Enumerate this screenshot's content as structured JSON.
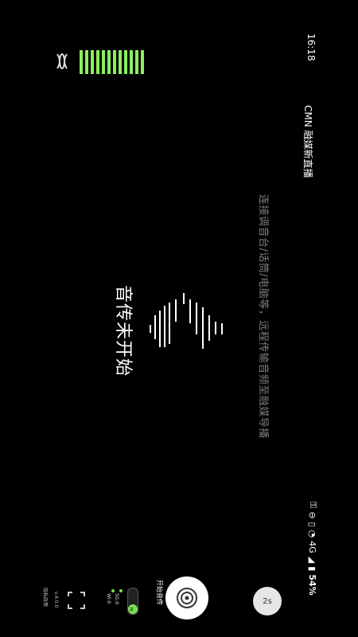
{
  "status_bar": {
    "time": "16:18",
    "network": "4G",
    "battery": "54%"
  },
  "app": {
    "title": "CMN 融媒新直播"
  },
  "hint": "连接调音台/话筒/电脑等，远程传输音频至融媒导播",
  "center": {
    "status": "音传未开始"
  },
  "controls": {
    "record_label": "开始音传",
    "timer_label": "2s",
    "net_5g": "5G:0",
    "net_wifi": "Wi:0",
    "toggle_text": "关",
    "version": "v.4.0.0",
    "privacy": "隐私政策"
  },
  "colors": {
    "meter_green": "#8bef5a",
    "toggle_green": "#7ee24e",
    "hint_gray": "#7d7d7d"
  }
}
